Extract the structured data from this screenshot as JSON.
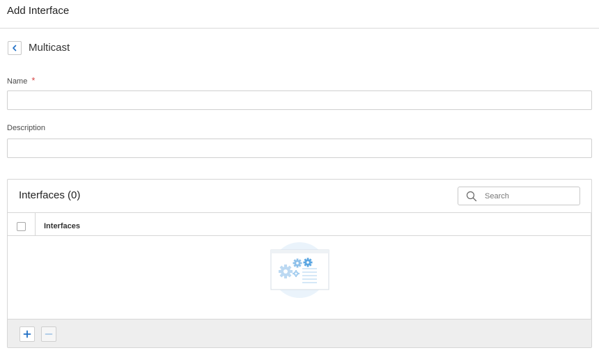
{
  "header": {
    "title": "Add Interface"
  },
  "section": {
    "title": "Multicast",
    "back_icon": "chevron-left-icon"
  },
  "form": {
    "name": {
      "label": "Name",
      "required_marker": "*",
      "value": "",
      "placeholder": ""
    },
    "description": {
      "label": "Description",
      "value": "",
      "placeholder": ""
    }
  },
  "interfaces_panel": {
    "title": "Interfaces (0)",
    "search": {
      "placeholder": "Search",
      "value": "",
      "icon": "search-icon"
    },
    "table": {
      "columns": [
        "Interfaces"
      ],
      "rows": []
    },
    "empty_state_icon": "empty-gears-illustration",
    "footer": {
      "add_icon": "plus-icon",
      "remove_icon": "minus-icon"
    }
  },
  "colors": {
    "accent": "#1f6fc5",
    "required": "#d64545",
    "border": "#cfcfcf",
    "footer_bg": "#eeeeee",
    "illustration": "#bcd9f2"
  }
}
